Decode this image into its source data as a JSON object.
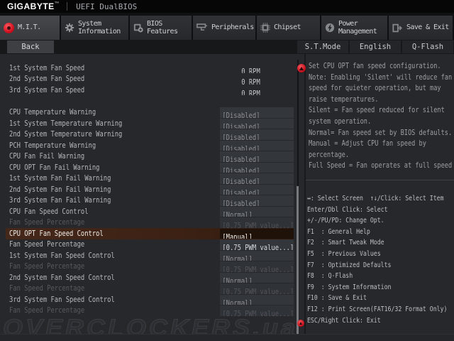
{
  "header": {
    "brand": "GIGABYTE",
    "brand_mark": "™",
    "title": "UEFI DualBIOS"
  },
  "tabs": [
    {
      "label": "M.I.T.",
      "icon": "mit-red-dot-icon",
      "active": true
    },
    {
      "label": "System Information",
      "icon": "gear-icon",
      "active": false
    },
    {
      "label": "BIOS Features",
      "icon": "bios-features-icon",
      "active": false
    },
    {
      "label": "Peripherals",
      "icon": "peripherals-icon",
      "active": false
    },
    {
      "label": "Chipset",
      "icon": "chipset-icon",
      "active": false
    },
    {
      "label": "Power Management",
      "icon": "power-icon",
      "active": false
    },
    {
      "label": "Save & Exit",
      "icon": "save-exit-icon",
      "active": false
    }
  ],
  "toolbar": {
    "back_label": "Back",
    "buttons": [
      "S.T.Mode",
      "English",
      "Q-Flash"
    ]
  },
  "settings": {
    "rows": [
      {
        "label": "1st System Fan Speed",
        "value": "0 RPM",
        "kind": "rpm",
        "state": "normal"
      },
      {
        "label": "2nd System Fan Speed",
        "value": "0 RPM",
        "kind": "rpm",
        "state": "normal"
      },
      {
        "label": "3rd System Fan Speed",
        "value": "0 RPM",
        "kind": "rpm",
        "state": "normal"
      },
      {
        "label": "CPU Temperature Warning",
        "value": "[Disabled]",
        "kind": "option",
        "state": "normal",
        "gap_before": true
      },
      {
        "label": "1st System Temperature Warning",
        "value": "[Disabled]",
        "kind": "option",
        "state": "normal"
      },
      {
        "label": "2nd System Temperature Warning",
        "value": "[Disabled]",
        "kind": "option",
        "state": "normal"
      },
      {
        "label": "PCH Temperature Warning",
        "value": "[Disabled]",
        "kind": "option",
        "state": "normal"
      },
      {
        "label": "CPU Fan Fail Warning",
        "value": "[Disabled]",
        "kind": "option",
        "state": "normal"
      },
      {
        "label": "CPU OPT Fan Fail Warning",
        "value": "[Disabled]",
        "kind": "option",
        "state": "normal"
      },
      {
        "label": "1st System Fan Fail Warning",
        "value": "[Disabled]",
        "kind": "option",
        "state": "normal"
      },
      {
        "label": "2nd System Fan Fail Warning",
        "value": "[Disabled]",
        "kind": "option",
        "state": "normal"
      },
      {
        "label": "3rd System Fan Fail Warning",
        "value": "[Disabled]",
        "kind": "option",
        "state": "normal"
      },
      {
        "label": "CPU Fan Speed Control",
        "value": "[Normal]",
        "kind": "option",
        "state": "normal"
      },
      {
        "label": "Fan Speed Percentage",
        "value": "[0.75 PWM value...]",
        "kind": "option",
        "state": "dimmed"
      },
      {
        "label": "CPU OPT Fan Speed Control",
        "value": "[Manual]",
        "kind": "option",
        "state": "selected"
      },
      {
        "label": "Fan Speed Percentage",
        "value": "[0.75 PWM value...]",
        "kind": "option",
        "state": "active"
      },
      {
        "label": "1st System Fan Speed Control",
        "value": "[Normal]",
        "kind": "option",
        "state": "normal"
      },
      {
        "label": "Fan Speed Percentage",
        "value": "[0.75 PWM value...]",
        "kind": "option",
        "state": "dimmed"
      },
      {
        "label": "2nd System Fan Speed Control",
        "value": "[Normal]",
        "kind": "option",
        "state": "normal"
      },
      {
        "label": "Fan Speed Percentage",
        "value": "[0.75 PWM value...]",
        "kind": "option",
        "state": "dimmed"
      },
      {
        "label": "3rd System Fan Speed Control",
        "value": "[Normal]",
        "kind": "option",
        "state": "normal"
      },
      {
        "label": "Fan Speed Percentage",
        "value": "[0.75 PWM value...]",
        "kind": "option",
        "state": "dimmed"
      }
    ]
  },
  "help": {
    "lines": [
      "Set CPU OPT fan speed configuration.",
      "Note: Enabling 'Silent' will reduce fan",
      "speed for quieter operation, but may",
      "raise temperatures.",
      "Silent = Fan speed reduced for silent",
      "system operation.",
      "Normal= Fan speed set by BIOS defaults.",
      "Manual = Adjust CPU fan speed by",
      "percentage.",
      "Full Speed = Fan operates at full speed"
    ]
  },
  "shortcuts": {
    "lines": [
      "↔: Select Screen  ↑↓/Click: Select Item",
      "Enter/Dbl Click: Select",
      "+/-/PU/PD: Change Opt.",
      "F1  : General Help",
      "F2  : Smart Tweak Mode",
      "F5  : Previous Values",
      "F7  : Optimized Defaults",
      "F8  : Q-Flash",
      "F9  : System Information",
      "F10 : Save & Exit",
      "F12 : Print Screen(FAT16/32 Format Only)",
      "ESC/Right Click: Exit"
    ]
  },
  "watermark": "OVERCLOCKERS.ua",
  "colors": {
    "accent_red": "#d21120",
    "selected_row_bg": "#3a2013",
    "panel_bg": "#26282b",
    "value_box_bg": "#33363b"
  }
}
